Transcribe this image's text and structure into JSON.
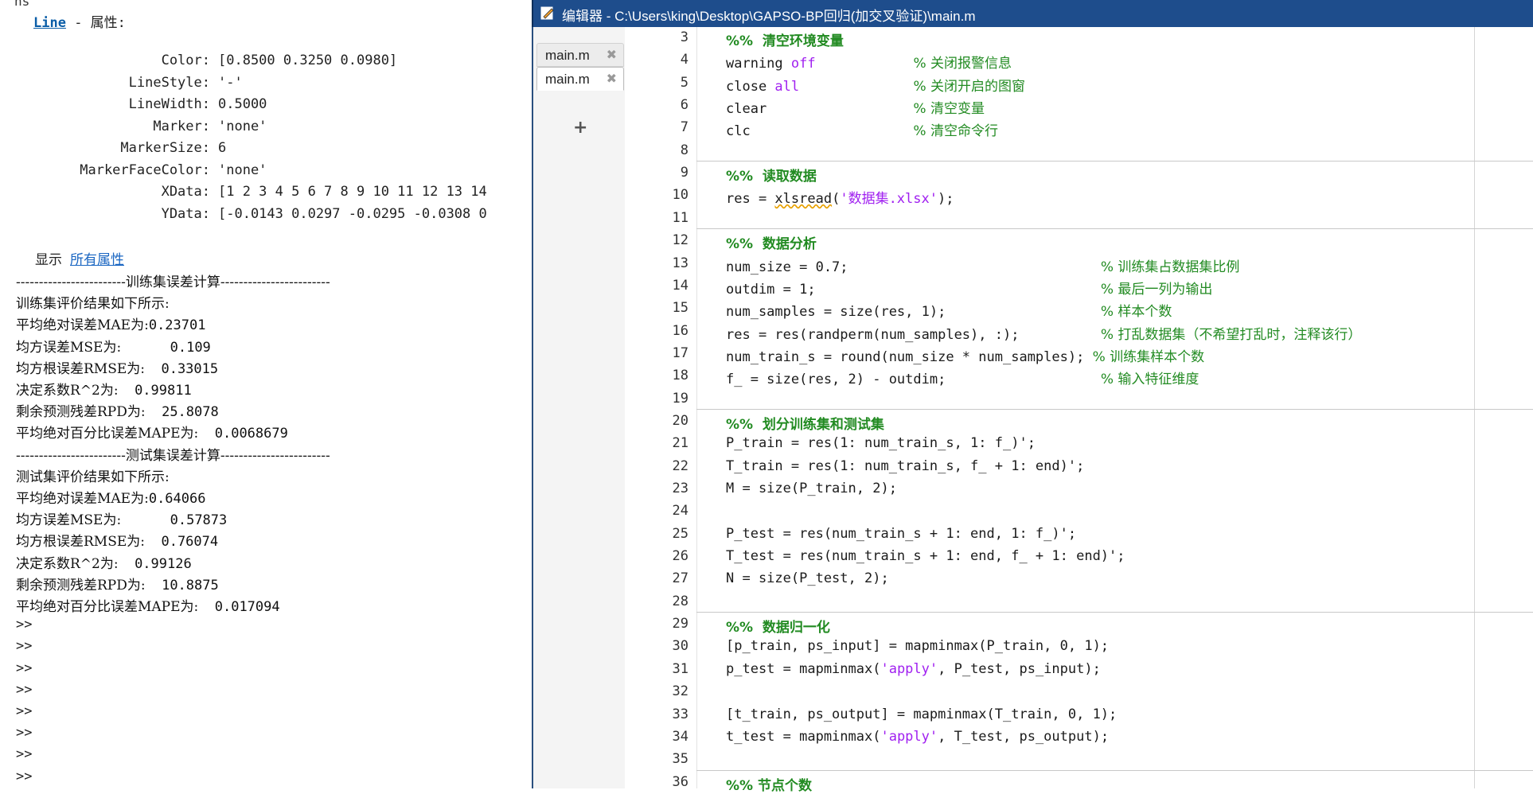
{
  "command_window": {
    "top_clip": "ns",
    "header_link": "Line",
    "header_rest": " - 属性:",
    "properties": [
      {
        "key": "Color:",
        "value": "[0.8500 0.3250 0.0980]"
      },
      {
        "key": "LineStyle:",
        "value": "'-'"
      },
      {
        "key": "LineWidth:",
        "value": "0.5000"
      },
      {
        "key": "Marker:",
        "value": "'none'"
      },
      {
        "key": "MarkerSize:",
        "value": "6"
      },
      {
        "key": "MarkerFaceColor:",
        "value": "'none'"
      },
      {
        "key": "XData:",
        "value": "[1 2 3 4 5 6 7 8 9 10 11 12 13 14"
      },
      {
        "key": "YData:",
        "value": "[-0.0143 0.0297 -0.0295 -0.0308 0"
      }
    ],
    "show_label": "显示",
    "show_link": "所有属性",
    "train_divider": "------------------------训练集误差计算------------------------",
    "train_lines": [
      {
        "label": "训练集评价结果如下所示:",
        "value": ""
      },
      {
        "label": "平均绝对误差MAE为:",
        "value": "0.23701"
      },
      {
        "label": "均方误差MSE为:",
        "value": "      0.109"
      },
      {
        "label": "均方根误差RMSE为:",
        "value": "  0.33015"
      },
      {
        "label": "决定系数R^2为:",
        "value": "  0.99811"
      },
      {
        "label": "剩余预测残差RPD为:",
        "value": "  25.8078"
      },
      {
        "label": "平均绝对百分比误差MAPE为:",
        "value": "  0.0068679"
      }
    ],
    "test_divider": "------------------------测试集误差计算------------------------",
    "test_lines": [
      {
        "label": "测试集评价结果如下所示:",
        "value": ""
      },
      {
        "label": "平均绝对误差MAE为:",
        "value": "0.64066"
      },
      {
        "label": "均方误差MSE为:",
        "value": "      0.57873"
      },
      {
        "label": "均方根误差RMSE为:",
        "value": "  0.76074"
      },
      {
        "label": "决定系数R^2为:",
        "value": "  0.99126"
      },
      {
        "label": "剩余预测残差RPD为:",
        "value": "  10.8875"
      },
      {
        "label": "平均绝对百分比误差MAPE为:",
        "value": "  0.017094"
      }
    ],
    "prompts": [
      ">>",
      ">>",
      ">>",
      ">>",
      ">>",
      ">>",
      ">>",
      ">>"
    ]
  },
  "editor": {
    "title": "编辑器 - C:\\Users\\king\\Desktop\\GAPSO-BP回归(加交叉验证)\\main.m",
    "tabs": [
      {
        "label": "main.m",
        "close": "✖"
      },
      {
        "label": "main.m",
        "close": "✖"
      }
    ],
    "add_tab": "+",
    "lines": [
      {
        "n": "3",
        "code": "",
        "sec": "%%  清空环境变量",
        "cm": ""
      },
      {
        "n": "4",
        "code": "warning ",
        "kw": "off",
        "pad": "            ",
        "cm": "% 关闭报警信息"
      },
      {
        "n": "5",
        "code": "close ",
        "kw": "all",
        "pad": "              ",
        "cm": "% 关闭开启的图窗"
      },
      {
        "n": "6",
        "code": "clear                  ",
        "cm": "% 清空变量"
      },
      {
        "n": "7",
        "code": "clc                    ",
        "cm": "% 清空命令行"
      },
      {
        "n": "8",
        "code": ""
      },
      {
        "n": "9",
        "code": "",
        "sec": "%%  读取数据"
      },
      {
        "n": "10",
        "code": "res = ",
        "wavy": "xlsread",
        "rest": "(",
        "str": "'数据集.xlsx'",
        "tail": ");"
      },
      {
        "n": "11",
        "code": ""
      },
      {
        "n": "12",
        "code": "",
        "sec": "%%  数据分析"
      },
      {
        "n": "13",
        "code": "num_size = 0.7;                               ",
        "cm": "% 训练集占数据集比例"
      },
      {
        "n": "14",
        "code": "outdim = 1;                                   ",
        "cm": "% 最后一列为输出"
      },
      {
        "n": "15",
        "code": "num_samples = size(res, 1);                   ",
        "cm": "% 样本个数"
      },
      {
        "n": "16",
        "code": "res = res(randperm(num_samples), :);          ",
        "cm": "% 打乱数据集（不希望打乱时，注释该行）"
      },
      {
        "n": "17",
        "code": "num_train_s = round(num_size * num_samples); ",
        "cm": "% 训练集样本个数"
      },
      {
        "n": "18",
        "code": "f_ = size(res, 2) - outdim;                   ",
        "cm": "% 输入特征维度"
      },
      {
        "n": "19",
        "code": ""
      },
      {
        "n": "20",
        "code": "",
        "sec": "%%  划分训练集和测试集"
      },
      {
        "n": "21",
        "code": "P_train = res(1: num_train_s, 1: f_)';"
      },
      {
        "n": "22",
        "code": "T_train = res(1: num_train_s, f_ + 1: end)';"
      },
      {
        "n": "23",
        "code": "M = size(P_train, 2);"
      },
      {
        "n": "24",
        "code": ""
      },
      {
        "n": "25",
        "code": "P_test = res(num_train_s + 1: end, 1: f_)';"
      },
      {
        "n": "26",
        "code": "T_test = res(num_train_s + 1: end, f_ + 1: end)';"
      },
      {
        "n": "27",
        "code": "N = size(P_test, 2);"
      },
      {
        "n": "28",
        "code": ""
      },
      {
        "n": "29",
        "code": "",
        "sec": "%%  数据归一化"
      },
      {
        "n": "30",
        "code": "[p_train, ps_input] = mapminmax(P_train, 0, 1);"
      },
      {
        "n": "31",
        "code": "p_test = mapminmax(",
        "str": "'apply'",
        "tail": ", P_test, ps_input);"
      },
      {
        "n": "32",
        "code": ""
      },
      {
        "n": "33",
        "code": "[t_train, ps_output] = mapminmax(T_train, 0, 1);"
      },
      {
        "n": "34",
        "code": "t_test = mapminmax(",
        "str": "'apply'",
        "tail": ", T_test, ps_output);"
      },
      {
        "n": "35",
        "code": ""
      },
      {
        "n": "36",
        "code": "",
        "sec": "%% 节点个数"
      }
    ]
  },
  "colors": {
    "titlebar": "#1e4d8c",
    "comment": "#228b22",
    "keyword": "#a020f0",
    "link": "#1a66c2"
  }
}
